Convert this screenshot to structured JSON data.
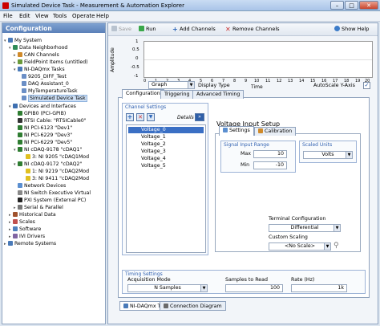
{
  "window": {
    "title": "Simulated Device Task - Measurement & Automation Explorer",
    "minimize": "–",
    "maximize": "□",
    "close": "✕"
  },
  "menu": [
    "File",
    "Edit",
    "View",
    "Tools",
    "Operate",
    "Help"
  ],
  "sidebar": {
    "header": "Configuration",
    "items": [
      "My System",
      "Data Neighborhood",
      "CAN Channels",
      "FieldPoint Items (untitled)",
      "NI-DAQmx Tasks",
      "9205_DIFF_Test",
      "DAQ Assistant_0",
      "MyTemperatureTask",
      "Simulated Device Task",
      "Devices and Interfaces",
      "GPIB0 (PCI-GPIB)",
      "RTSI Cable: \"RTSICable0\"",
      "NI PCI-6123 \"Dev1\"",
      "NI PCI-6229 \"Dev3\"",
      "NI PCI-6229 \"Dev5\"",
      "NI cDAQ-9178 \"cDAQ1\"",
      "3: NI 9205 \"cDAQ1Mod",
      "NI cDAQ-9172 \"cDAQ2\"",
      "1: NI 9219 \"cDAQ2Mod",
      "3: NI 9411 \"cDAQ2Mod",
      "Network Devices",
      "NI Switch Executive Virtual",
      "PXI System (External PC)",
      "Serial & Parallel",
      "Historical Data",
      "Scales",
      "Software",
      "IVI Drivers",
      "Remote Systems"
    ]
  },
  "toolbar": {
    "save": "Save",
    "run": "Run",
    "add_channels": "Add Channels",
    "remove_channels": "Remove Channels",
    "show_help": "Show Help"
  },
  "graph": {
    "ylabel": "Amplitude",
    "xlabel": "Time",
    "y_ticks": [
      "1",
      "0.5",
      "0",
      "-0.5",
      "-1"
    ],
    "x_ticks": [
      "0",
      "1",
      "2",
      "3",
      "4",
      "5",
      "6",
      "7",
      "8",
      "9",
      "10",
      "11",
      "12",
      "13",
      "14",
      "15",
      "16",
      "17",
      "18",
      "19",
      "20"
    ],
    "graph_type": "Graph",
    "display_type_label": "Display Type",
    "autoscale_label": "AutoScale Y-Axis"
  },
  "tabs": [
    "Configuration",
    "Triggering",
    "Advanced Timing"
  ],
  "channel_settings": {
    "group_label": "Channel Settings",
    "details": "Details",
    "channels": [
      "Voltage_0",
      "Voltage_1",
      "Voltage_2",
      "Voltage_3",
      "Voltage_4",
      "Voltage_5"
    ]
  },
  "voltage_setup": {
    "title": "Voltage Input Setup",
    "tab_settings": "Settings",
    "tab_calibration": "Calibration",
    "signal_range_label": "Signal Input Range",
    "max_label": "Max",
    "max_value": "10",
    "min_label": "Min",
    "min_value": "-10",
    "scaled_units_label": "Scaled Units",
    "scaled_units_value": "Volts",
    "terminal_label": "Terminal Configuration",
    "terminal_value": "Differential",
    "scaling_label": "Custom Scaling",
    "scaling_value": "<No Scale>"
  },
  "timing": {
    "group_label": "Timing Settings",
    "mode_label": "Acquisition Mode",
    "mode_value": "N Samples",
    "samples_label": "Samples to Read",
    "samples_value": "100",
    "rate_label": "Rate (Hz)",
    "rate_value": "1k"
  },
  "bottom_tabs": [
    "NI-DAQmx Task",
    "Connection Diagram"
  ]
}
